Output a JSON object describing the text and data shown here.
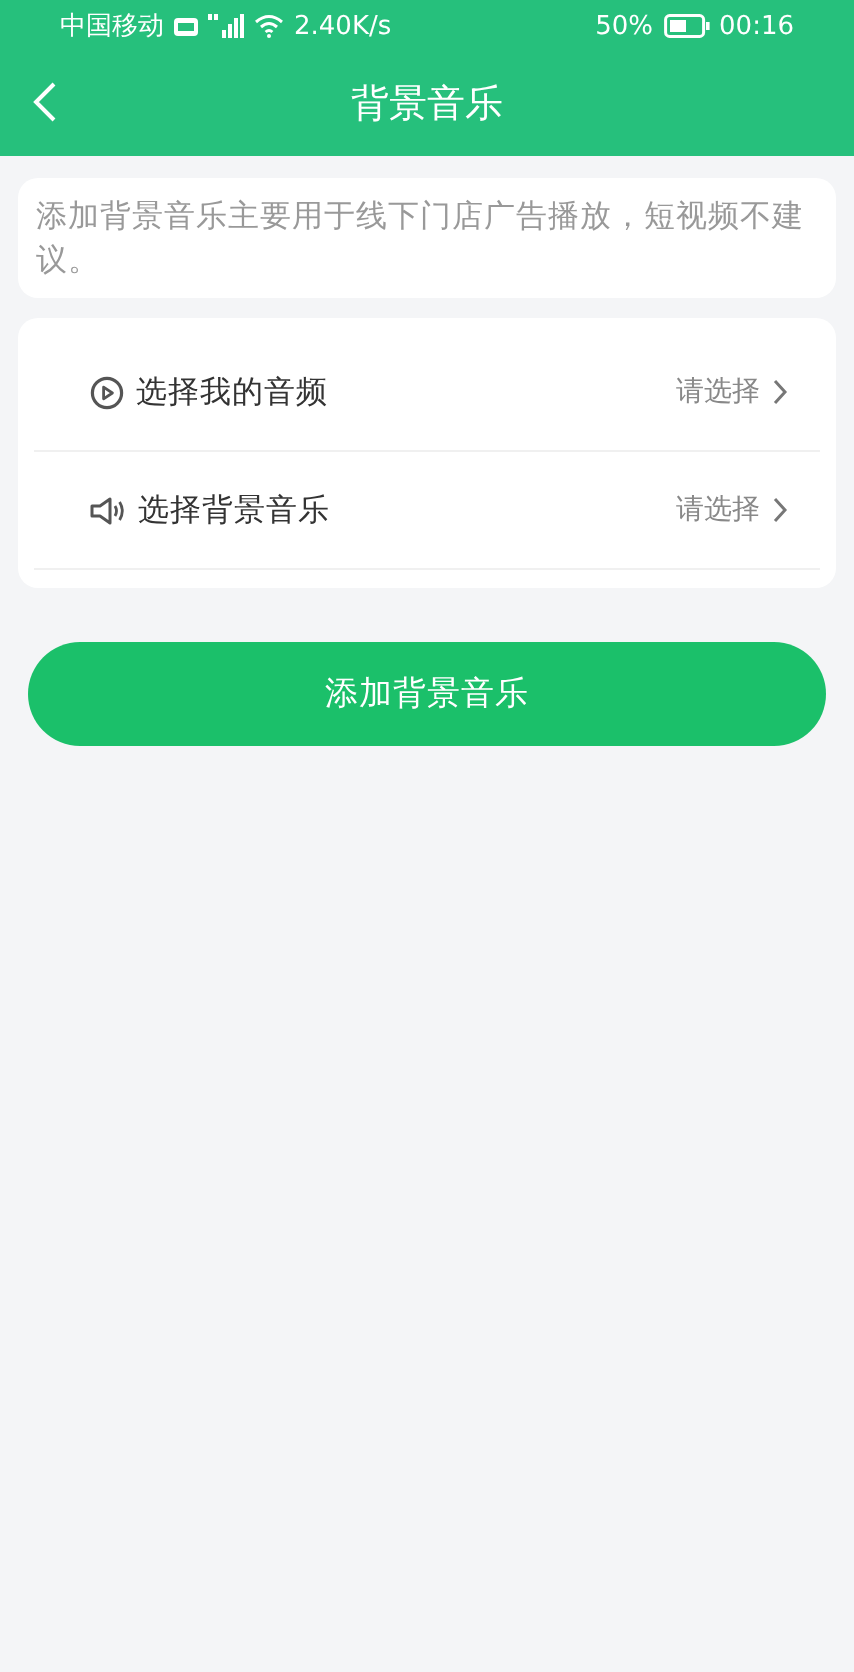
{
  "status_bar": {
    "carrier": "中国移动",
    "speed": "2.40K/s",
    "battery": "50%",
    "time": "00:16"
  },
  "header": {
    "title": "背景音乐"
  },
  "notice": "添加背景音乐主要用于线下门店广告播放，短视频不建议。",
  "rows": [
    {
      "kind": "play",
      "label": "选择我的音频",
      "value": "请选择"
    },
    {
      "kind": "speaker",
      "label": "选择背景音乐",
      "value": "请选择"
    }
  ],
  "button": "添加背景音乐"
}
